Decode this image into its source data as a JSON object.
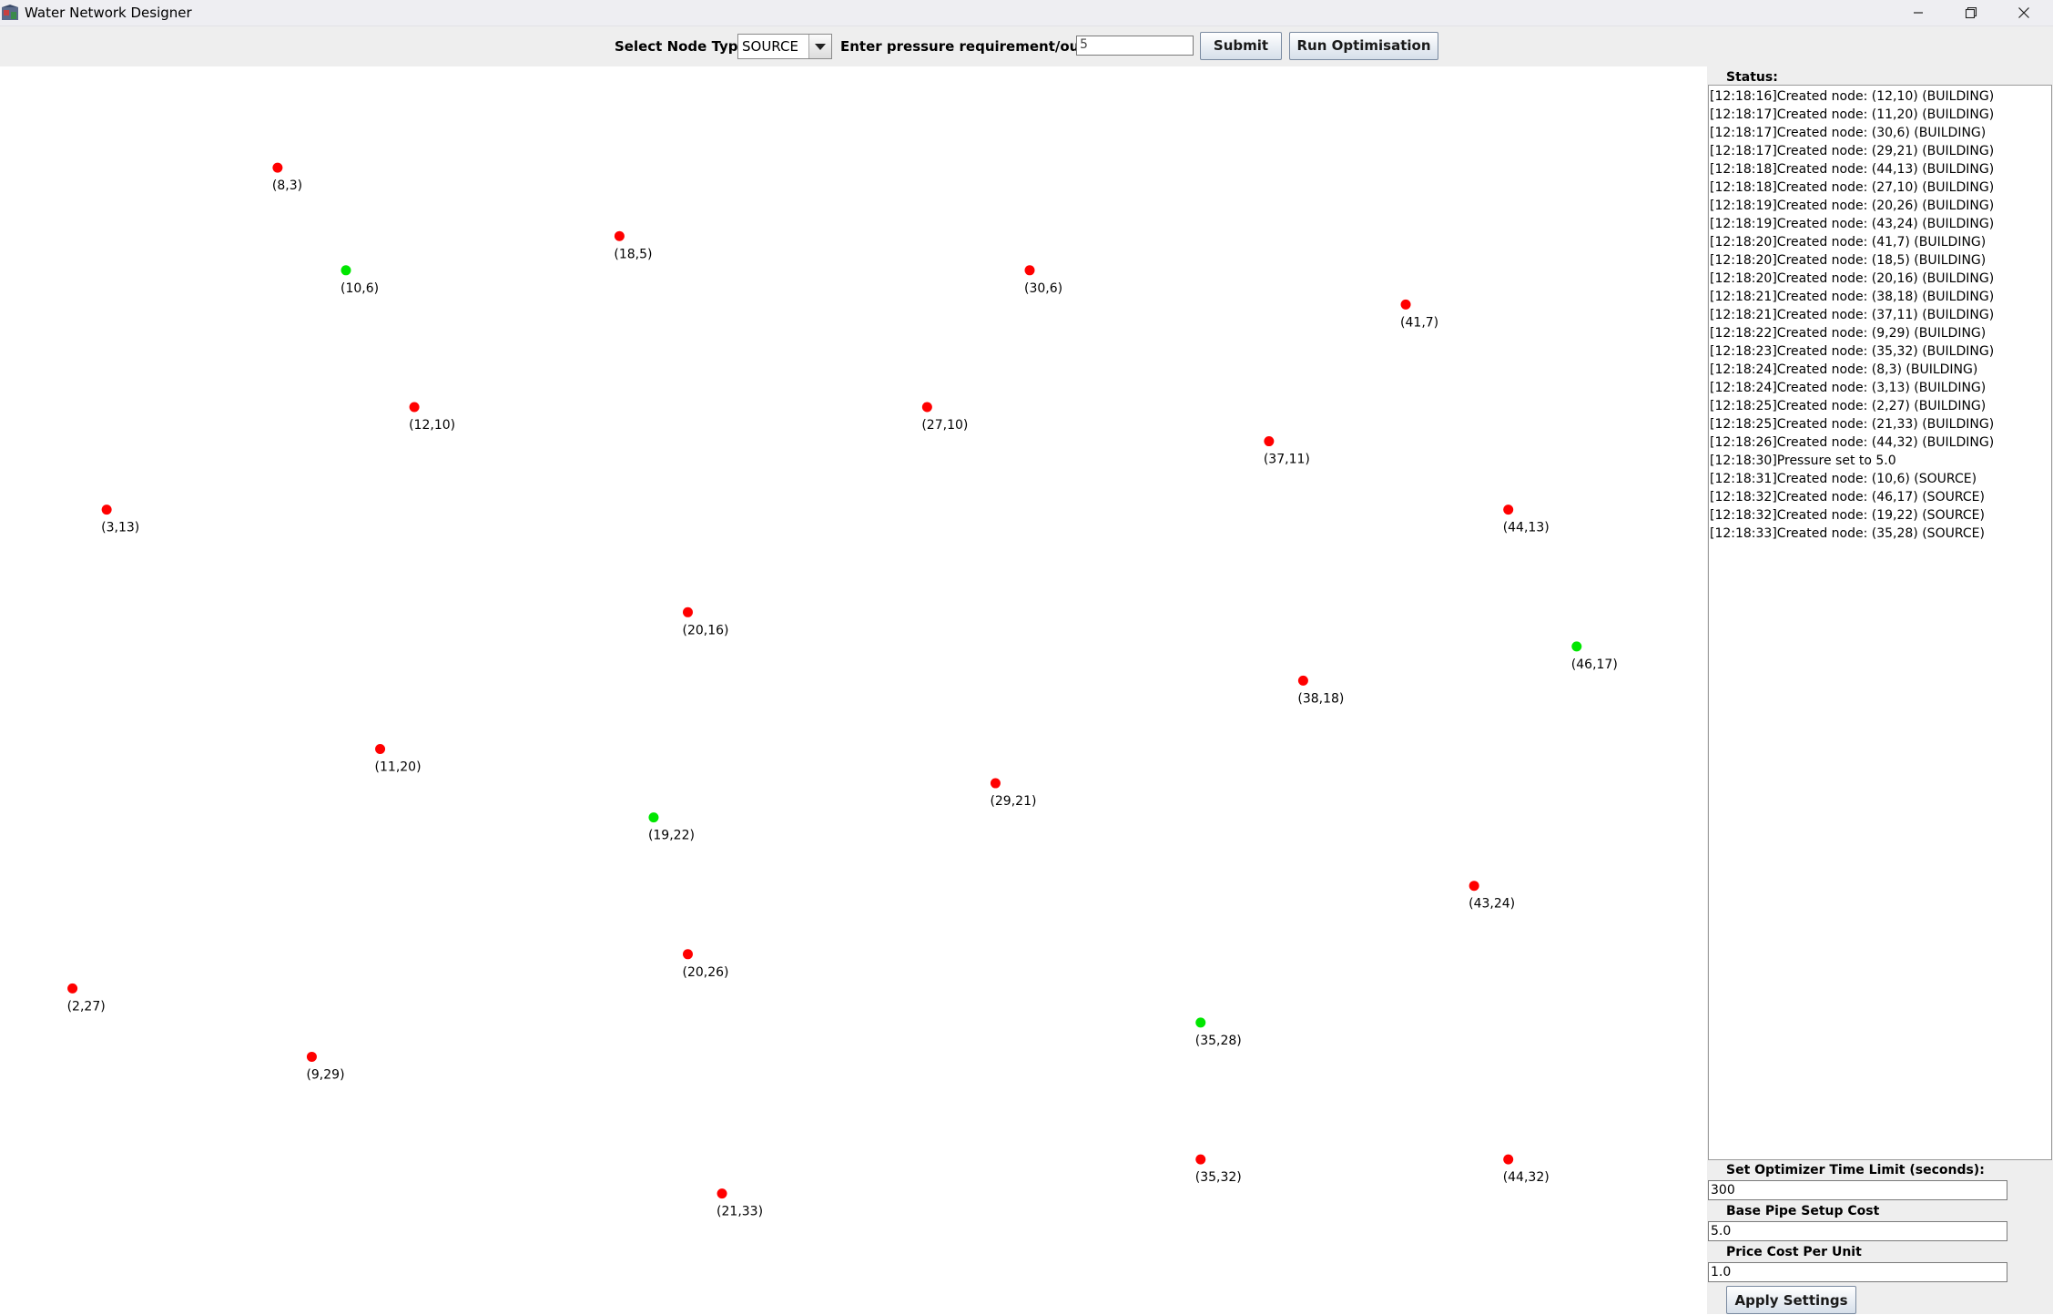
{
  "window": {
    "title": "Water Network Designer",
    "icon": "app-window-icon",
    "controls": [
      "minimize-icon",
      "restore-icon",
      "close-icon"
    ]
  },
  "toolbar": {
    "node_type_label": "Select Node Type:",
    "node_type_value": "SOURCE",
    "pressure_label": "Enter pressure requirement/output:",
    "pressure_value": "5",
    "submit_label": "Submit",
    "run_label": "Run Optimisation"
  },
  "colors": {
    "building": "#ff0000",
    "source": "#00e600"
  },
  "canvas": {
    "nodes": [
      {
        "label": "(8,3)",
        "type": "BUILDING"
      },
      {
        "label": "(18,5)",
        "type": "BUILDING"
      },
      {
        "label": "(10,6)",
        "type": "SOURCE"
      },
      {
        "label": "(30,6)",
        "type": "BUILDING"
      },
      {
        "label": "(41,7)",
        "type": "BUILDING"
      },
      {
        "label": "(12,10)",
        "type": "BUILDING"
      },
      {
        "label": "(27,10)",
        "type": "BUILDING"
      },
      {
        "label": "(37,11)",
        "type": "BUILDING"
      },
      {
        "label": "(3,13)",
        "type": "BUILDING"
      },
      {
        "label": "(44,13)",
        "type": "BUILDING"
      },
      {
        "label": "(20,16)",
        "type": "BUILDING"
      },
      {
        "label": "(46,17)",
        "type": "SOURCE"
      },
      {
        "label": "(38,18)",
        "type": "BUILDING"
      },
      {
        "label": "(11,20)",
        "type": "BUILDING"
      },
      {
        "label": "(29,21)",
        "type": "BUILDING"
      },
      {
        "label": "(19,22)",
        "type": "SOURCE"
      },
      {
        "label": "(43,24)",
        "type": "BUILDING"
      },
      {
        "label": "(20,26)",
        "type": "BUILDING"
      },
      {
        "label": "(2,27)",
        "type": "BUILDING"
      },
      {
        "label": "(35,28)",
        "type": "SOURCE"
      },
      {
        "label": "(9,29)",
        "type": "BUILDING"
      },
      {
        "label": "(35,32)",
        "type": "BUILDING"
      },
      {
        "label": "(44,32)",
        "type": "BUILDING"
      },
      {
        "label": "(21,33)",
        "type": "BUILDING"
      }
    ]
  },
  "status": {
    "label": "Status:",
    "log": [
      "[12:18:16]Created node: (12,10) (BUILDING)",
      "[12:18:17]Created node: (11,20) (BUILDING)",
      "[12:18:17]Created node: (30,6) (BUILDING)",
      "[12:18:17]Created node: (29,21) (BUILDING)",
      "[12:18:18]Created node: (44,13) (BUILDING)",
      "[12:18:18]Created node: (27,10) (BUILDING)",
      "[12:18:19]Created node: (20,26) (BUILDING)",
      "[12:18:19]Created node: (43,24) (BUILDING)",
      "[12:18:20]Created node: (41,7) (BUILDING)",
      "[12:18:20]Created node: (18,5) (BUILDING)",
      "[12:18:20]Created node: (20,16) (BUILDING)",
      "[12:18:21]Created node: (38,18) (BUILDING)",
      "[12:18:21]Created node: (37,11) (BUILDING)",
      "[12:18:22]Created node: (9,29) (BUILDING)",
      "[12:18:23]Created node: (35,32) (BUILDING)",
      "[12:18:24]Created node: (8,3) (BUILDING)",
      "[12:18:24]Created node: (3,13) (BUILDING)",
      "[12:18:25]Created node: (2,27) (BUILDING)",
      "[12:18:25]Created node: (21,33) (BUILDING)",
      "[12:18:26]Created node: (44,32) (BUILDING)",
      "[12:18:30]Pressure set to 5.0",
      "[12:18:31]Created node: (10,6) (SOURCE)",
      "[12:18:32]Created node: (46,17) (SOURCE)",
      "[12:18:32]Created node: (19,22) (SOURCE)",
      "[12:18:33]Created node: (35,28) (SOURCE)"
    ]
  },
  "settings": {
    "time_limit_label": "Set Optimizer Time Limit (seconds):",
    "time_limit_value": "300",
    "base_cost_label": "Base Pipe Setup Cost",
    "base_cost_value": "5.0",
    "unit_cost_label": "Price Cost Per Unit",
    "unit_cost_value": "1.0",
    "apply_label": "Apply Settings"
  }
}
